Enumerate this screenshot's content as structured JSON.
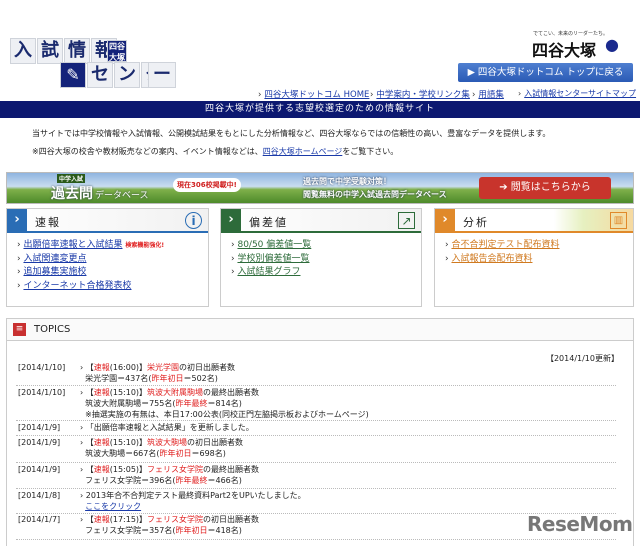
{
  "logo": {
    "tiles_top": [
      "入",
      "試",
      "情",
      "報"
    ],
    "badge": "四谷大塚",
    "tiles_bottom": [
      "セ",
      "ン",
      "タ",
      "ー"
    ],
    "brand_tagline": "でてこい、未来のリーダーたち。",
    "brand_name": "四谷大塚"
  },
  "header": {
    "top_button": "▶ 四谷大塚ドットコム トップに戻る",
    "nav": [
      "四谷大塚ドットコム HOME",
      "中学案内・学校リンク集",
      "用語集",
      "入試情報センターサイトマップ"
    ]
  },
  "band": "四谷大塚が提供する志望校選定のための情報サイト",
  "intro": {
    "line1": "当サイトでは中学校情報や入試情報、公開模試結果をもとにした分析情報など、四谷大塚ならではの信頼性の高い、豊富なデータを提供します。",
    "line2_prefix": "※四谷大塚の校舎や教材販売などの案内、イベント情報などは、",
    "line2_link": "四谷大塚ホームページ",
    "line2_suffix": "をご覧下さい。"
  },
  "banner": {
    "small": "中学入試",
    "title": "過去問",
    "sub": "データベース",
    "badge": "現在306校掲載中!",
    "copy1": "過去問で中学受験対策！",
    "copy2": "閲覧無料の中学入試過去問データベース",
    "button": "閲覧はこちらから"
  },
  "boxes": [
    {
      "title": "速報",
      "color": "#2a6db5",
      "items": [
        "出願倍率速報と入試結果",
        "入試関連変更点",
        "追加募集実施校",
        "インターネット合格発表校"
      ],
      "badge": "検索機能強化!"
    },
    {
      "title": "偏差値",
      "color": "#2d6b3a",
      "items": [
        "80/50 偏差値一覧",
        "学校別偏差値一覧",
        "入試結果グラフ"
      ]
    },
    {
      "title": "分析",
      "color": "#e0892a",
      "items": [
        "合不合判定テスト配布資料",
        "入試報告会配布資料"
      ]
    }
  ],
  "topics": {
    "title": "TOPICS",
    "updated": "【2014/1/10更新】",
    "rows": [
      {
        "date": "[2014/1/10]",
        "a": "【",
        "b": "速報",
        "c": "(16:00)】",
        "d": "栄光学園",
        "e": "の初日出願者数",
        "l2a": "栄光学園＝437名(",
        "l2b": "昨年初日",
        "l2c": "＝502名)"
      },
      {
        "date": "[2014/1/10]",
        "a": "【",
        "b": "速報",
        "c": "(15:10)】",
        "d": "筑波大附属駒場",
        "e": "の最終出願者数",
        "l2a": "筑波大附属駒場＝755名(",
        "l2b": "昨年最終",
        "l2c": "＝814名)",
        "l3": "※抽選実施の有無は、本日17:00公表(同校正門左脇掲示板およびホームページ)"
      },
      {
        "date": "[2014/1/9]",
        "plain": "「出願倍率速報と入試結果」を更新しました。"
      },
      {
        "date": "[2014/1/9]",
        "a": "【",
        "b": "速報",
        "c": "(15:10)】",
        "d": "筑波大駒場",
        "e": "の初日出願者数",
        "l2a": "筑波大駒場＝667名(",
        "l2b": "昨年初日",
        "l2c": "＝698名)"
      },
      {
        "date": "[2014/1/9]",
        "a": "【",
        "b": "速報",
        "c": "(15:05)】",
        "d": "フェリス女学院",
        "e": "の最終出願者数",
        "l2a": "フェリス女学院＝396名(",
        "l2b": "昨年最終",
        "l2c": "＝466名)"
      },
      {
        "date": "[2014/1/8]",
        "plain": "2013年合不合判定テスト最終資料Part2をUPいたしました。",
        "link": "ここをクリック"
      },
      {
        "date": "[2014/1/7]",
        "a": "【",
        "b": "速報",
        "c": "(17:15)】",
        "d": "フェリス女学院",
        "e": "の初日出願者数",
        "l2a": "フェリス女学院＝357名(",
        "l2b": "昨年初日",
        "l2c": "＝418名)"
      }
    ]
  },
  "watermark": "ReseMom"
}
